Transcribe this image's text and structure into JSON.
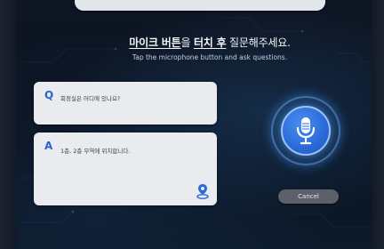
{
  "instruction": {
    "part1": "마이크 버튼",
    "part2": "을 ",
    "part3": "터치 후",
    "part4": " 질문해주세요.",
    "english": "Tap the microphone button and ask questions."
  },
  "question": {
    "letter": "Q",
    "text": "회정실은 어디에 있나요?"
  },
  "answer": {
    "letter": "A",
    "text": "1층, 2층 무역에 위치합니다."
  },
  "cancel_label": "Cancel",
  "icons": {
    "mic": "microphone-icon",
    "location": "location-pin-icon"
  },
  "colors": {
    "accent": "#2a63c9",
    "mic_blue": "#2a6ad8",
    "wave_left": "#5a6bff",
    "wave_right": "#b03ad8",
    "card_bg": "#e9ebef",
    "cancel_bg": "#5b6069"
  }
}
